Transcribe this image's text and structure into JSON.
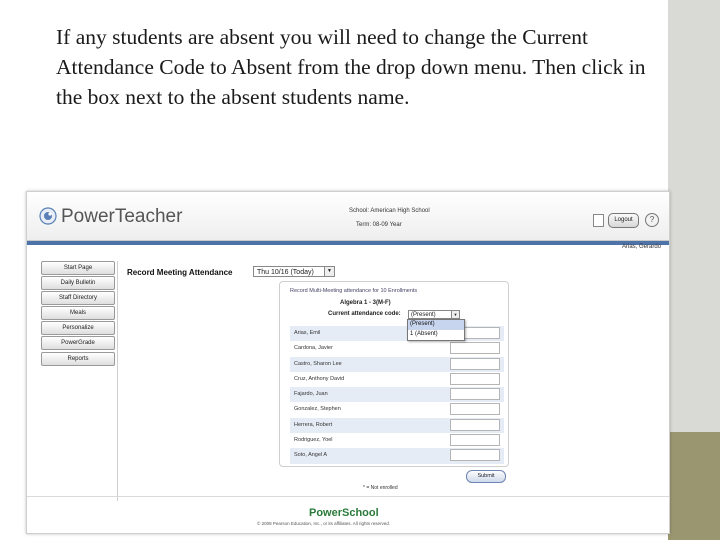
{
  "instruction_text": "If any students are absent you will need to change the Current Attendance Code to Absent from the drop down menu. Then click in the box next to the absent students name.",
  "app": {
    "logo_text": "PowerTeacher",
    "school_line": "School: American High School",
    "term_line": "Term: 08-09 Year",
    "logout_label": "Logout",
    "help_label": "?",
    "user_name": "Arias, Gerardo"
  },
  "sidebar": {
    "items": [
      {
        "label": "Start Page"
      },
      {
        "label": "Daily Bulletin"
      },
      {
        "label": "Staff Directory"
      },
      {
        "label": "Meals"
      },
      {
        "label": "Personalize"
      },
      {
        "label": "PowerGrade"
      },
      {
        "label": "Reports"
      }
    ]
  },
  "attendance": {
    "title": "Record Meeting Attendance",
    "date_value": "Thu 10/16 (Today)",
    "panel_instruction": "Record Multi-Meeting attendance for 10 Enrollments",
    "course_title": "Algebra 1 - 3(M-F)",
    "current_code_label": "Current attendance code:",
    "current_code_value": "(Present)",
    "dropdown_options": [
      "(Present)",
      "1 (Absent)"
    ],
    "students": [
      {
        "name": "Arias, Emil"
      },
      {
        "name": "Cardona, Javier"
      },
      {
        "name": "Castro, Sharon Lee"
      },
      {
        "name": "Cruz, Anthony David"
      },
      {
        "name": "Fajardo, Juan"
      },
      {
        "name": "Gonzalez, Stephen"
      },
      {
        "name": "Herrera, Robert"
      },
      {
        "name": "Rodriguez, Yoel"
      },
      {
        "name": "Soto, Angel A"
      }
    ],
    "submit_label": "Submit",
    "legend_text": "* = Not enrolled"
  },
  "footer": {
    "logo_text": "PowerSchool",
    "copyright": "© 2008 Pearson Education, Inc., or its affiliates. All rights reserved."
  },
  "colors": {
    "nav_bar_blue": "#4e73a8",
    "row_stripe": "#e6ecf5",
    "powerschool_green": "#2a7a3a",
    "slide_band": "#d9d9d6",
    "slide_band_accent": "#9a9670"
  }
}
